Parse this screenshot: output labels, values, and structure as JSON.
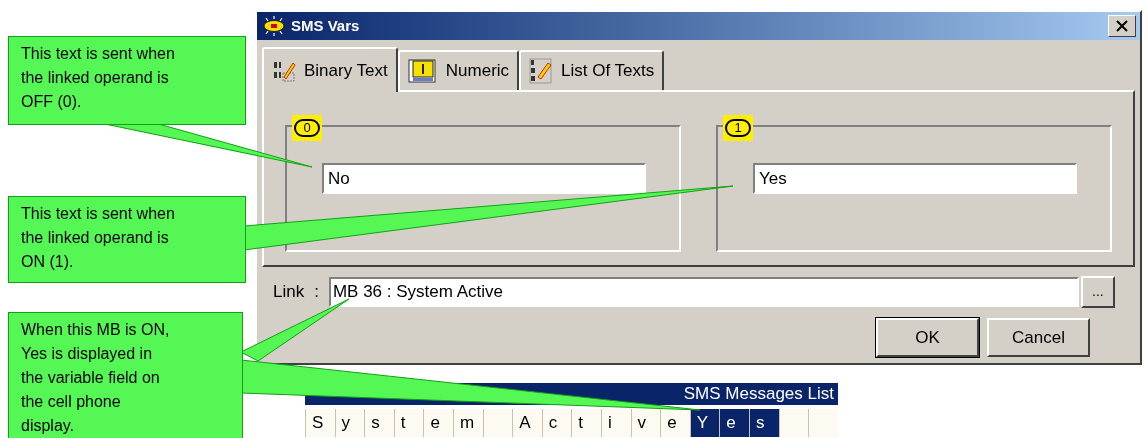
{
  "window": {
    "title": "SMS Vars"
  },
  "tabs": [
    {
      "label": "Binary Text",
      "selected": true,
      "kind": "binary"
    },
    {
      "label": "Numeric",
      "selected": false,
      "kind": "numeric"
    },
    {
      "label": "List Of Texts",
      "selected": false,
      "kind": "list"
    }
  ],
  "groups": [
    {
      "badge": "0",
      "value": "No"
    },
    {
      "badge": "1",
      "value": "Yes"
    }
  ],
  "link": {
    "label": "Link",
    "separator": ":",
    "value": "MB 36 : System Active",
    "browse": "..."
  },
  "buttons": [
    {
      "label": "OK",
      "default": true
    },
    {
      "label": "Cancel",
      "default": false
    }
  ],
  "callouts": [
    {
      "text": "This text is sent when\nthe linked operand is\nOFF (0)."
    },
    {
      "text": "This text is sent when\nthe linked operand is\nON (1)."
    },
    {
      "text": "When this MB is ON,\nYes is displayed in\nthe variable field on\nthe cell phone\ndisplay."
    }
  ],
  "sms_list": {
    "title": "SMS Messages List",
    "cells": [
      {
        "char": "S",
        "selected": false
      },
      {
        "char": "y",
        "selected": false
      },
      {
        "char": "s",
        "selected": false
      },
      {
        "char": "t",
        "selected": false
      },
      {
        "char": "e",
        "selected": false
      },
      {
        "char": "m",
        "selected": false
      },
      {
        "selected": false
      },
      {
        "char": "A",
        "selected": false
      },
      {
        "char": "c",
        "selected": false
      },
      {
        "char": "t",
        "selected": false
      },
      {
        "char": "i",
        "selected": false
      },
      {
        "char": "v",
        "selected": false
      },
      {
        "char": "e",
        "selected": false
      },
      {
        "char": "Y",
        "selected": true
      },
      {
        "char": "e",
        "selected": true
      },
      {
        "char": "s",
        "selected": true
      },
      {
        "selected": false
      },
      {
        "selected": false
      }
    ]
  }
}
